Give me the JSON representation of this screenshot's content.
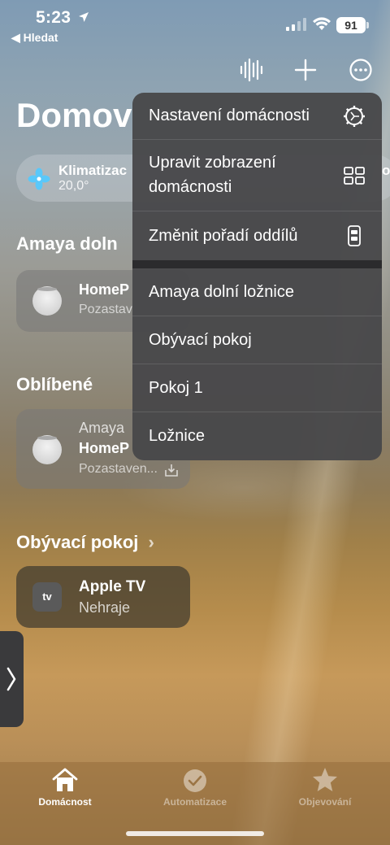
{
  "status_bar": {
    "time": "5:23",
    "back_label": "◀ Hledat",
    "battery": "91"
  },
  "toolbar": {
    "voice_icon": "waveform-icon",
    "add_icon": "plus-icon",
    "more_icon": "ellipsis-circle-icon"
  },
  "home": {
    "title": "Domov"
  },
  "climate_chip": {
    "title": "Klimatizac",
    "value": "20,0°",
    "trailing": "o"
  },
  "sections": [
    {
      "title": "Amaya doln",
      "tiles": [
        {
          "name": "HomeP",
          "subtitle": "Pozastav"
        }
      ]
    },
    {
      "title": "Oblíbené",
      "tiles": [
        {
          "prefix": "Amaya",
          "name": "HomeP",
          "subtitle": "Pozastaven..."
        }
      ]
    },
    {
      "title": "Obývací pokoj",
      "chevron": "›",
      "tiles": [
        {
          "icon_text": "tv",
          "name": "Apple TV",
          "subtitle": "Nehraje"
        }
      ]
    }
  ],
  "menu": {
    "items": [
      {
        "label": "Nastavení domácnosti",
        "icon": "gear-icon"
      },
      {
        "label": "Upravit zobrazení domácnosti",
        "label_line1": "Upravit zobrazení",
        "label_line2": "domácnosti",
        "icon": "grid-icon"
      },
      {
        "label": "Změnit pořadí oddílů",
        "icon": "reorder-icon"
      },
      {
        "label": "Amaya dolní ložnice"
      },
      {
        "label": "Obývací pokoj"
      },
      {
        "label": "Pokoj 1"
      },
      {
        "label": "Ložnice"
      }
    ]
  },
  "tabbar": {
    "tabs": [
      {
        "label": "Domácnost",
        "icon": "house-icon",
        "active": true
      },
      {
        "label": "Automatizace",
        "icon": "clock-icon",
        "active": false
      },
      {
        "label": "Objevování",
        "icon": "star-icon",
        "active": false
      }
    ]
  },
  "colors": {
    "menu_bg": "#48484a",
    "tab_active": "#ffffff",
    "climate_icon": "#5ac8fa"
  }
}
